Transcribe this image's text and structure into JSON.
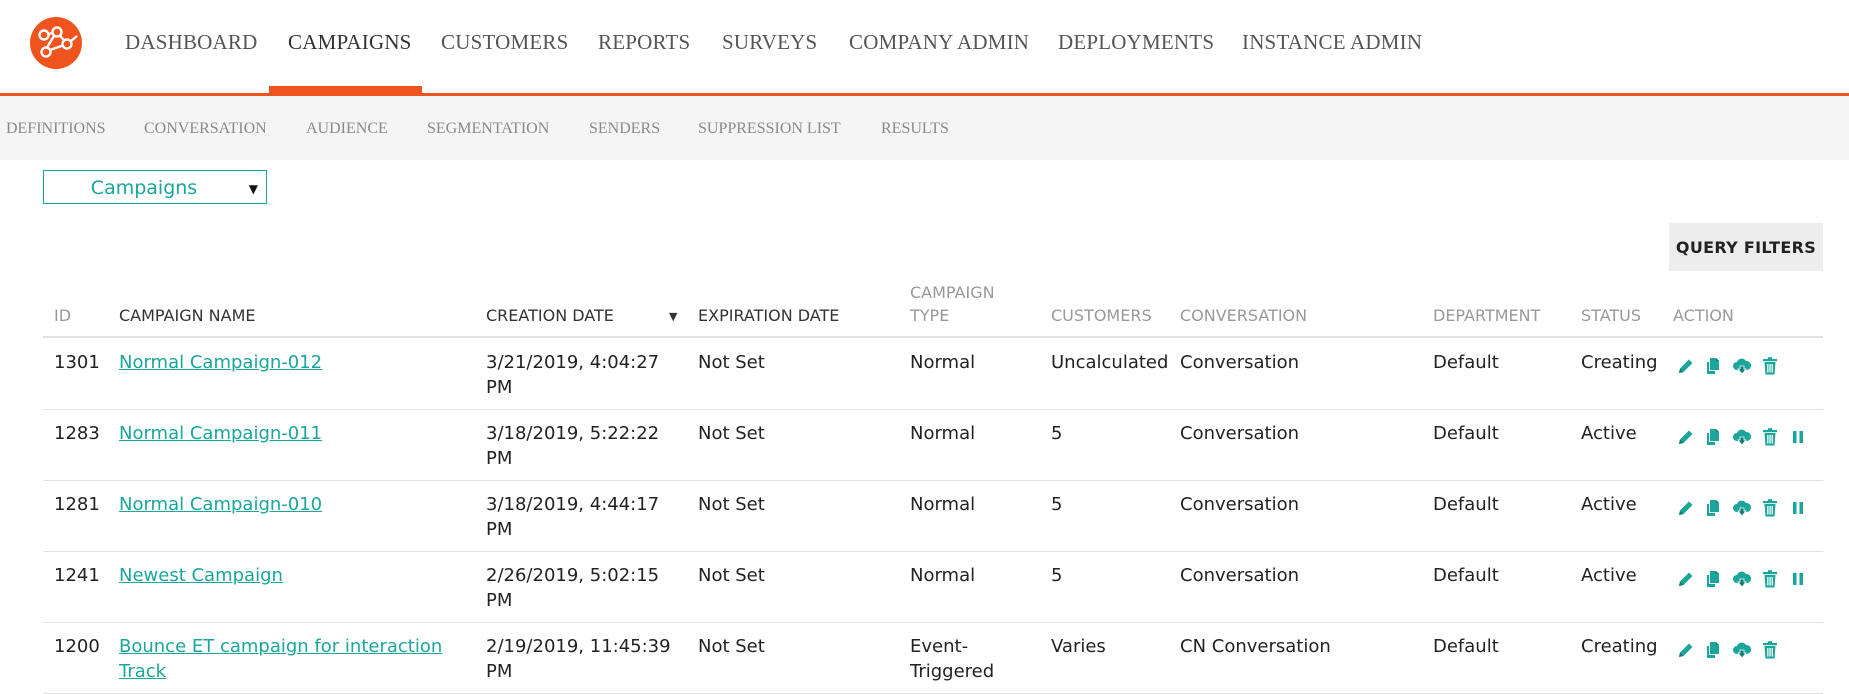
{
  "brand": {
    "logo": "network-logo",
    "accent": "#f0541e",
    "teal": "#1aa69a"
  },
  "topnav": {
    "items": [
      "DASHBOARD",
      "CAMPAIGNS",
      "CUSTOMERS",
      "REPORTS",
      "SURVEYS",
      "COMPANY ADMIN",
      "DEPLOYMENTS",
      "INSTANCE ADMIN"
    ],
    "active": "CAMPAIGNS"
  },
  "subnav": {
    "items": [
      "DEFINITIONS",
      "CONVERSATION",
      "AUDIENCE",
      "SEGMENTATION",
      "SENDERS",
      "SUPPRESSION LIST",
      "RESULTS"
    ]
  },
  "selector": {
    "value": "Campaigns"
  },
  "query_filters": {
    "label": "QUERY FILTERS"
  },
  "table": {
    "headers": {
      "id": "ID",
      "name": "CAMPAIGN NAME",
      "created": "CREATION DATE",
      "expires": "EXPIRATION DATE",
      "type_line1": "CAMPAIGN",
      "type_line2": "TYPE",
      "customers": "CUSTOMERS",
      "conversation": "CONVERSATION",
      "department": "DEPARTMENT",
      "status": "STATUS",
      "action": "ACTION"
    },
    "sorted_by": "CREATION DATE",
    "rows": [
      {
        "id": "1301",
        "name_l1": "Normal Campaign-012",
        "name_l2": "",
        "created_l1": "3/21/2019, 4:04:27",
        "created_l2": "PM",
        "expires": "Not Set",
        "type_l1": "Normal",
        "type_l2": "",
        "customers": "Uncalculated",
        "conversation": "Conversation",
        "department": "Default",
        "status": "Creating",
        "actions": [
          "edit-icon",
          "copy-icon",
          "cloud-download-icon",
          "trash-icon"
        ]
      },
      {
        "id": "1283",
        "name_l1": "Normal Campaign-011",
        "name_l2": "",
        "created_l1": "3/18/2019, 5:22:22",
        "created_l2": "PM",
        "expires": "Not Set",
        "type_l1": "Normal",
        "type_l2": "",
        "customers": "5",
        "conversation": "Conversation",
        "department": "Default",
        "status": "Active",
        "actions": [
          "edit-icon",
          "copy-icon",
          "cloud-download-icon",
          "trash-icon",
          "pause-icon"
        ]
      },
      {
        "id": "1281",
        "name_l1": "Normal Campaign-010",
        "name_l2": "",
        "created_l1": "3/18/2019, 4:44:17",
        "created_l2": "PM",
        "expires": "Not Set",
        "type_l1": "Normal",
        "type_l2": "",
        "customers": "5",
        "conversation": "Conversation",
        "department": "Default",
        "status": "Active",
        "actions": [
          "edit-icon",
          "copy-icon",
          "cloud-download-icon",
          "trash-icon",
          "pause-icon"
        ]
      },
      {
        "id": "1241",
        "name_l1": "Newest Campaign",
        "name_l2": "",
        "created_l1": "2/26/2019, 5:02:15",
        "created_l2": "PM",
        "expires": "Not Set",
        "type_l1": "Normal",
        "type_l2": "",
        "customers": "5",
        "conversation": "Conversation",
        "department": "Default",
        "status": "Active",
        "actions": [
          "edit-icon",
          "copy-icon",
          "cloud-download-icon",
          "trash-icon",
          "pause-icon"
        ]
      },
      {
        "id": "1200",
        "name_l1": "Bounce ET campaign for interaction",
        "name_l2": "Track",
        "created_l1": "2/19/2019, 11:45:39",
        "created_l2": "PM",
        "expires": "Not Set",
        "type_l1": "Event-",
        "type_l2": "Triggered",
        "customers": "Varies",
        "conversation": "CN Conversation",
        "department": "Default",
        "status": "Creating",
        "actions": [
          "edit-icon",
          "copy-icon",
          "cloud-download-icon",
          "trash-icon"
        ]
      }
    ]
  }
}
